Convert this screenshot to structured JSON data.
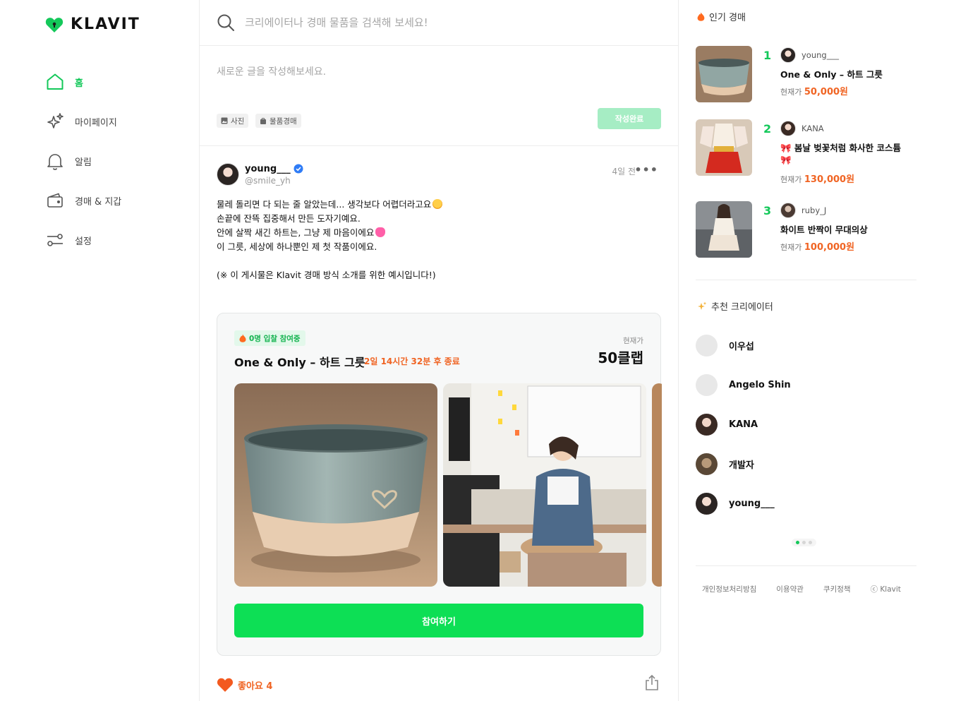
{
  "brand": {
    "name": "KLAVIT",
    "accent": "#14c85a",
    "accent_light": "#a6edc4",
    "highlight": "#f06423"
  },
  "sidebar": {
    "items": [
      {
        "label": "홈",
        "icon": "home-icon",
        "active": true
      },
      {
        "label": "마이페이지",
        "icon": "sparkle-icon",
        "active": false
      },
      {
        "label": "알림",
        "icon": "bell-icon",
        "active": false
      },
      {
        "label": "경매 & 지갑",
        "icon": "wallet-icon",
        "active": false
      },
      {
        "label": "설정",
        "icon": "settings-toggle-icon",
        "active": false
      }
    ]
  },
  "search": {
    "placeholder": "크리에이터나 경매 물품을 검색해 보세요!"
  },
  "composer": {
    "placeholder": "새로운 글을 작성해보세요.",
    "photo_label": "사진",
    "auction_label": "물품경매",
    "submit_label": "작성완료"
  },
  "post": {
    "author": "young___",
    "handle": "@smile_yh",
    "time": "4일 전",
    "lines": [
      "물레 돌리면 다 되는 줄 알았는데... 생각보다 어렵더라고요",
      "손끝에 잔뜩 집중해서 만든 도자기예요.",
      "안에 살짝 새긴 하트는, 그냥 제 마음이에요",
      "이 그릇, 세상에 하나뿐인 제 첫 작품이에요.",
      "(※ 이 게시물은 Klavit 경매 방식 소개를 위한 예시입니다!)"
    ],
    "auction": {
      "badge": "0명 입찰 참여중",
      "title": "One & Only – 하트 그릇",
      "remaining": "2일 14시간 32분 후 종료",
      "price_label": "현재가",
      "price": "50클랩",
      "join_label": "참여하기"
    },
    "like_label": "좋아요 4"
  },
  "popular": {
    "title": "인기 경매",
    "items": [
      {
        "rank": "1",
        "user": "young___",
        "name": "One & Only – 하트 그릇",
        "price_label": "현재가",
        "price": "50,000원"
      },
      {
        "rank": "2",
        "user": "KANA",
        "name": "🎀 봄날 벚꽃처럼 화사한 코스튬",
        "name2": "🎀",
        "price_label": "현재가",
        "price": "130,000원"
      },
      {
        "rank": "3",
        "user": "ruby_J",
        "name": "화이트 반짝이 무대의상",
        "price_label": "현재가",
        "price": "100,000원"
      }
    ]
  },
  "creators": {
    "title": "추천 크리에이터",
    "items": [
      {
        "name": "이우섭"
      },
      {
        "name": "Angelo Shin"
      },
      {
        "name": "KANA"
      },
      {
        "name": "개발자"
      },
      {
        "name": "young___"
      }
    ]
  },
  "footer": {
    "links": [
      "개인정보처리방침",
      "이용약관",
      "쿠키정책",
      "ⓒ Klavit"
    ]
  }
}
